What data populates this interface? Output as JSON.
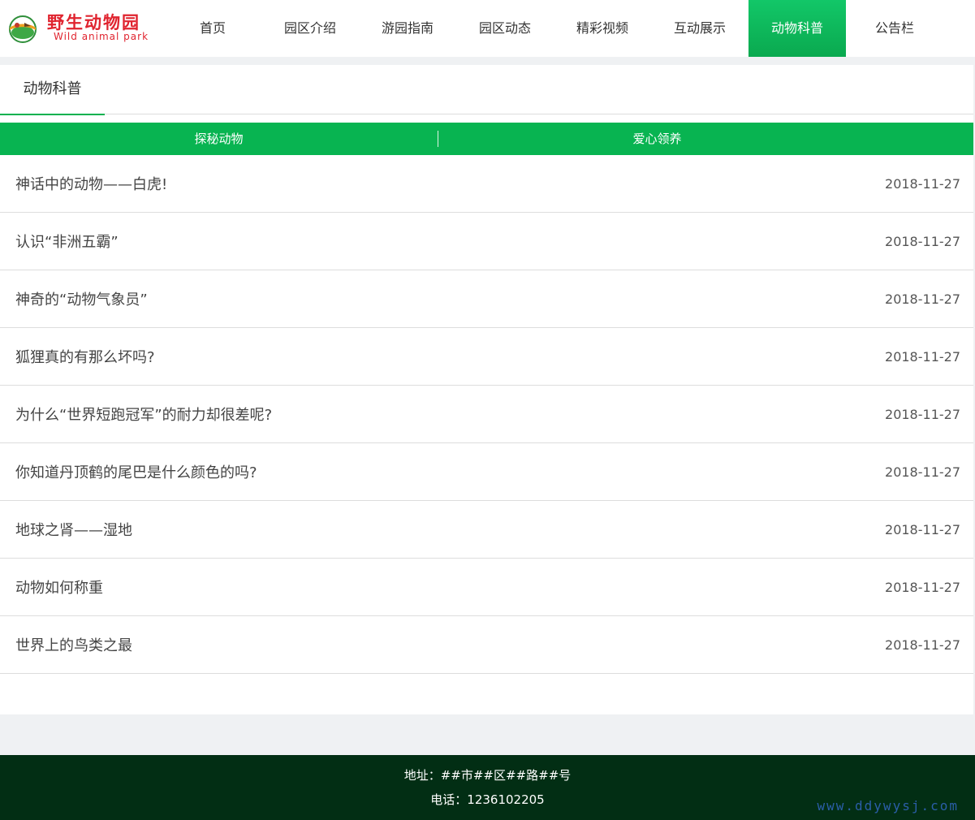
{
  "logo": {
    "title_cn": "野生动物园",
    "title_en": "Wild animal park"
  },
  "nav": {
    "items": [
      {
        "label": "首页"
      },
      {
        "label": "园区介绍"
      },
      {
        "label": "游园指南"
      },
      {
        "label": "园区动态"
      },
      {
        "label": "精彩视频"
      },
      {
        "label": "互动展示"
      },
      {
        "label": "动物科普"
      },
      {
        "label": "公告栏"
      }
    ],
    "active": "动物科普"
  },
  "section": {
    "title": "动物科普"
  },
  "subnav": {
    "items": [
      {
        "label": "探秘动物"
      },
      {
        "label": "爱心领养"
      }
    ]
  },
  "articles": [
    {
      "title": "神话中的动物——白虎!",
      "date": "2018-11-27"
    },
    {
      "title": "认识“非洲五霸”",
      "date": "2018-11-27"
    },
    {
      "title": "神奇的“动物气象员”",
      "date": "2018-11-27"
    },
    {
      "title": "狐狸真的有那么坏吗?",
      "date": "2018-11-27"
    },
    {
      "title": "为什么“世界短跑冠军”的耐力却很差呢?",
      "date": "2018-11-27"
    },
    {
      "title": "你知道丹顶鹤的尾巴是什么颜色的吗?",
      "date": "2018-11-27"
    },
    {
      "title": "地球之肾——湿地",
      "date": "2018-11-27"
    },
    {
      "title": "动物如何称重",
      "date": "2018-11-27"
    },
    {
      "title": "世界上的鸟类之最",
      "date": "2018-11-27"
    }
  ],
  "footer": {
    "address": "地址：##市##区##路##号",
    "phone": "电话：1236102205"
  },
  "watermark": "www.ddywysj.com",
  "colors": {
    "accent_green": "#08b451",
    "footer_bg": "#022e14",
    "logo_red": "#e0242f"
  }
}
